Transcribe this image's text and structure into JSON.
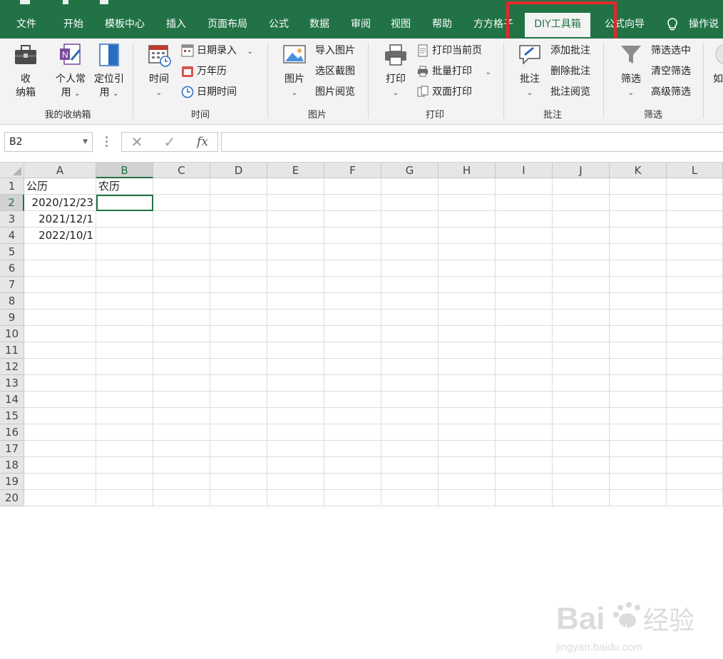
{
  "tabs": [
    {
      "label": "文件"
    },
    {
      "label": "开始"
    },
    {
      "label": "模板中心"
    },
    {
      "label": "插入"
    },
    {
      "label": "页面布局"
    },
    {
      "label": "公式"
    },
    {
      "label": "数据"
    },
    {
      "label": "审阅"
    },
    {
      "label": "视图"
    },
    {
      "label": "帮助"
    },
    {
      "label": "方方格子"
    },
    {
      "label": "DIY工具箱"
    },
    {
      "label": "公式向导"
    }
  ],
  "active_tab": "DIY工具箱",
  "tell_me": "操作说",
  "ribbon": {
    "group_mybox": {
      "label": "我的收纳箱",
      "btn_box_1": "收",
      "btn_box_2": "纳箱",
      "btn_personal_1": "个人常",
      "btn_personal_2": "用",
      "btn_locate_1": "定位引",
      "btn_locate_2": "用"
    },
    "group_time": {
      "label": "时间",
      "btn_time": "时间",
      "date_entry": "日期录入",
      "calendar": "万年历",
      "date_time": "日期时间"
    },
    "group_picture": {
      "label": "图片",
      "btn_picture": "图片",
      "import": "导入图片",
      "screenshot": "选区截图",
      "viewer": "图片阅览"
    },
    "group_print": {
      "label": "打印",
      "btn_print": "打印",
      "current_page": "打印当前页",
      "batch": "批量打印",
      "duplex": "双面打印"
    },
    "group_comment": {
      "label": "批注",
      "btn_comment": "批注",
      "add": "添加批注",
      "delete": "删除批注",
      "view": "批注阅览"
    },
    "group_filter": {
      "label": "筛选",
      "btn_filter": "筛选",
      "select_filter": "筛选选中",
      "clear_filter": "清空筛选",
      "advanced": "高级筛选"
    },
    "partial_next": "如"
  },
  "formula_bar": {
    "name_box": "B2",
    "fx": "fx",
    "formula": ""
  },
  "sheet": {
    "columns": [
      "A",
      "B",
      "C",
      "D",
      "E",
      "F",
      "G",
      "H",
      "I",
      "J",
      "K",
      "L"
    ],
    "rows": [
      "1",
      "2",
      "3",
      "4",
      "5",
      "6",
      "7",
      "8",
      "9",
      "10",
      "11",
      "12",
      "13",
      "14",
      "15",
      "16",
      "17",
      "18",
      "19",
      "20"
    ],
    "A1": "公历",
    "B1": "农历",
    "A2": "2020/12/23",
    "A3": "2021/12/1",
    "A4": "2022/10/1"
  },
  "watermark": {
    "brand": "Bai",
    "brand2": "du",
    "cn": "经验",
    "url": "jingyan.baidu.com"
  },
  "colors": {
    "excel_green": "#217346",
    "highlight_red": "#e8262b"
  }
}
